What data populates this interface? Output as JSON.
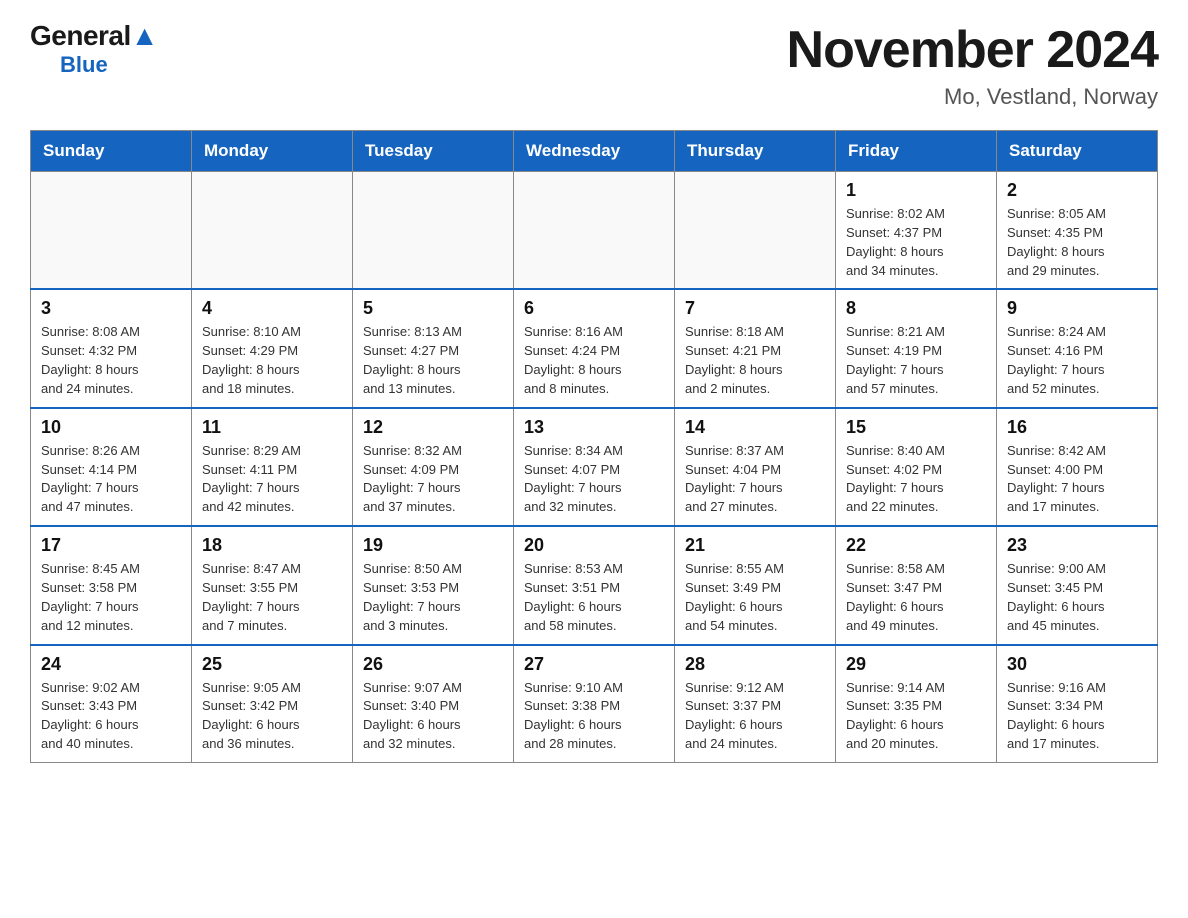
{
  "header": {
    "logo_general": "General",
    "logo_blue": "Blue",
    "month_title": "November 2024",
    "location": "Mo, Vestland, Norway"
  },
  "days_of_week": [
    "Sunday",
    "Monday",
    "Tuesday",
    "Wednesday",
    "Thursday",
    "Friday",
    "Saturday"
  ],
  "weeks": [
    [
      {
        "day": "",
        "info": ""
      },
      {
        "day": "",
        "info": ""
      },
      {
        "day": "",
        "info": ""
      },
      {
        "day": "",
        "info": ""
      },
      {
        "day": "",
        "info": ""
      },
      {
        "day": "1",
        "info": "Sunrise: 8:02 AM\nSunset: 4:37 PM\nDaylight: 8 hours\nand 34 minutes."
      },
      {
        "day": "2",
        "info": "Sunrise: 8:05 AM\nSunset: 4:35 PM\nDaylight: 8 hours\nand 29 minutes."
      }
    ],
    [
      {
        "day": "3",
        "info": "Sunrise: 8:08 AM\nSunset: 4:32 PM\nDaylight: 8 hours\nand 24 minutes."
      },
      {
        "day": "4",
        "info": "Sunrise: 8:10 AM\nSunset: 4:29 PM\nDaylight: 8 hours\nand 18 minutes."
      },
      {
        "day": "5",
        "info": "Sunrise: 8:13 AM\nSunset: 4:27 PM\nDaylight: 8 hours\nand 13 minutes."
      },
      {
        "day": "6",
        "info": "Sunrise: 8:16 AM\nSunset: 4:24 PM\nDaylight: 8 hours\nand 8 minutes."
      },
      {
        "day": "7",
        "info": "Sunrise: 8:18 AM\nSunset: 4:21 PM\nDaylight: 8 hours\nand 2 minutes."
      },
      {
        "day": "8",
        "info": "Sunrise: 8:21 AM\nSunset: 4:19 PM\nDaylight: 7 hours\nand 57 minutes."
      },
      {
        "day": "9",
        "info": "Sunrise: 8:24 AM\nSunset: 4:16 PM\nDaylight: 7 hours\nand 52 minutes."
      }
    ],
    [
      {
        "day": "10",
        "info": "Sunrise: 8:26 AM\nSunset: 4:14 PM\nDaylight: 7 hours\nand 47 minutes."
      },
      {
        "day": "11",
        "info": "Sunrise: 8:29 AM\nSunset: 4:11 PM\nDaylight: 7 hours\nand 42 minutes."
      },
      {
        "day": "12",
        "info": "Sunrise: 8:32 AM\nSunset: 4:09 PM\nDaylight: 7 hours\nand 37 minutes."
      },
      {
        "day": "13",
        "info": "Sunrise: 8:34 AM\nSunset: 4:07 PM\nDaylight: 7 hours\nand 32 minutes."
      },
      {
        "day": "14",
        "info": "Sunrise: 8:37 AM\nSunset: 4:04 PM\nDaylight: 7 hours\nand 27 minutes."
      },
      {
        "day": "15",
        "info": "Sunrise: 8:40 AM\nSunset: 4:02 PM\nDaylight: 7 hours\nand 22 minutes."
      },
      {
        "day": "16",
        "info": "Sunrise: 8:42 AM\nSunset: 4:00 PM\nDaylight: 7 hours\nand 17 minutes."
      }
    ],
    [
      {
        "day": "17",
        "info": "Sunrise: 8:45 AM\nSunset: 3:58 PM\nDaylight: 7 hours\nand 12 minutes."
      },
      {
        "day": "18",
        "info": "Sunrise: 8:47 AM\nSunset: 3:55 PM\nDaylight: 7 hours\nand 7 minutes."
      },
      {
        "day": "19",
        "info": "Sunrise: 8:50 AM\nSunset: 3:53 PM\nDaylight: 7 hours\nand 3 minutes."
      },
      {
        "day": "20",
        "info": "Sunrise: 8:53 AM\nSunset: 3:51 PM\nDaylight: 6 hours\nand 58 minutes."
      },
      {
        "day": "21",
        "info": "Sunrise: 8:55 AM\nSunset: 3:49 PM\nDaylight: 6 hours\nand 54 minutes."
      },
      {
        "day": "22",
        "info": "Sunrise: 8:58 AM\nSunset: 3:47 PM\nDaylight: 6 hours\nand 49 minutes."
      },
      {
        "day": "23",
        "info": "Sunrise: 9:00 AM\nSunset: 3:45 PM\nDaylight: 6 hours\nand 45 minutes."
      }
    ],
    [
      {
        "day": "24",
        "info": "Sunrise: 9:02 AM\nSunset: 3:43 PM\nDaylight: 6 hours\nand 40 minutes."
      },
      {
        "day": "25",
        "info": "Sunrise: 9:05 AM\nSunset: 3:42 PM\nDaylight: 6 hours\nand 36 minutes."
      },
      {
        "day": "26",
        "info": "Sunrise: 9:07 AM\nSunset: 3:40 PM\nDaylight: 6 hours\nand 32 minutes."
      },
      {
        "day": "27",
        "info": "Sunrise: 9:10 AM\nSunset: 3:38 PM\nDaylight: 6 hours\nand 28 minutes."
      },
      {
        "day": "28",
        "info": "Sunrise: 9:12 AM\nSunset: 3:37 PM\nDaylight: 6 hours\nand 24 minutes."
      },
      {
        "day": "29",
        "info": "Sunrise: 9:14 AM\nSunset: 3:35 PM\nDaylight: 6 hours\nand 20 minutes."
      },
      {
        "day": "30",
        "info": "Sunrise: 9:16 AM\nSunset: 3:34 PM\nDaylight: 6 hours\nand 17 minutes."
      }
    ]
  ]
}
